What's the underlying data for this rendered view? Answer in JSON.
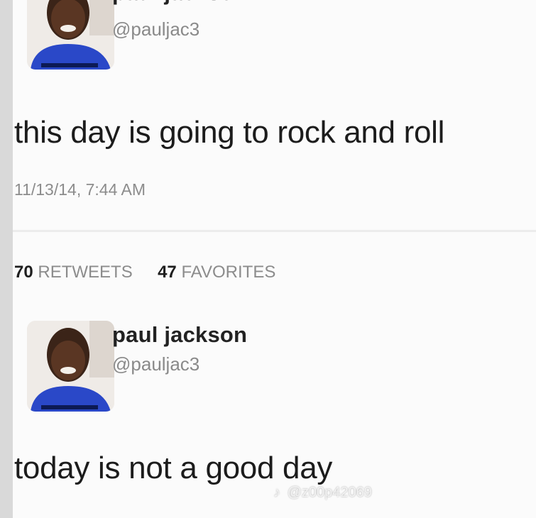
{
  "tweets": [
    {
      "name": "paul jackson",
      "handle": "@pauljac3",
      "text": "this day is going to rock and roll",
      "timestamp": "11/13/14, 7:44 AM",
      "retweets_count": "70",
      "retweets_label": "RETWEETS",
      "favorites_count": "47",
      "favorites_label": "FAVORITES"
    },
    {
      "name": "paul jackson",
      "handle": "@pauljac3",
      "text": "today is not a good day"
    }
  ],
  "watermark": {
    "icon": "tiktok-icon",
    "text": "@z00p42069"
  }
}
